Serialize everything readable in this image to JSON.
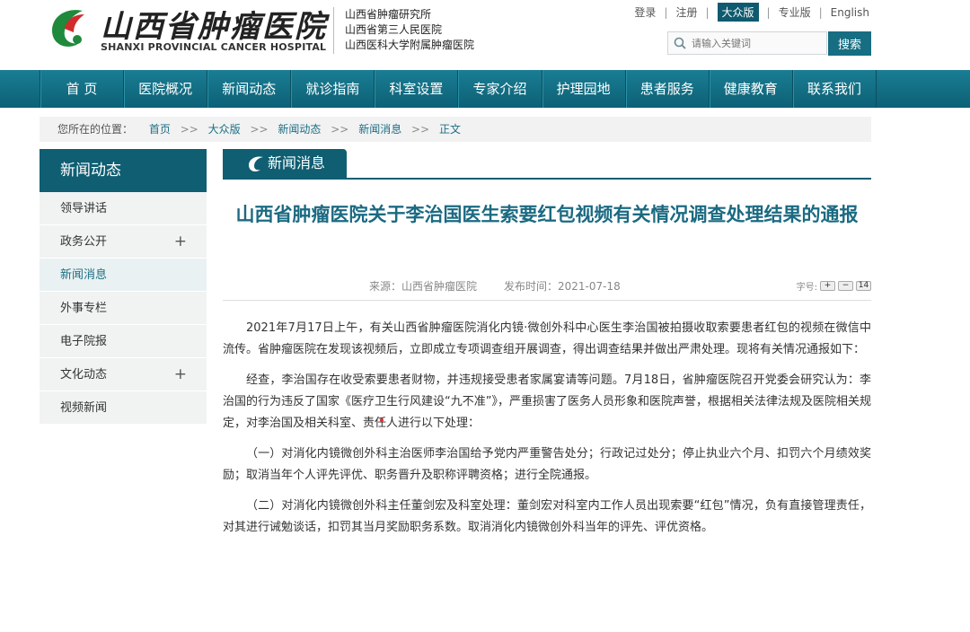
{
  "header": {
    "logo_cn": "山西省肿瘤医院",
    "logo_en": "SHANXI PROVINCIAL CANCER HOSPITAL",
    "affiliations": [
      "山西省肿瘤研究所",
      "山西省第三人民医院",
      "山西医科大学附属肿瘤医院"
    ],
    "topnav": {
      "login": "登录",
      "register": "注册",
      "public_version": "大众版",
      "pro_version": "专业版",
      "english": "English"
    },
    "search": {
      "placeholder": "请输入关键词",
      "button": "搜索"
    }
  },
  "mainnav": [
    "首 页",
    "医院概况",
    "新闻动态",
    "就诊指南",
    "科室设置",
    "专家介绍",
    "护理园地",
    "患者服务",
    "健康教育",
    "联系我们"
  ],
  "breadcrumb": {
    "prefix": "您所在的位置：",
    "items": [
      "首页",
      "大众版",
      "新闻动态",
      "新闻消息",
      "正文"
    ]
  },
  "sidebar": {
    "title": "新闻动态",
    "items": [
      {
        "label": "领导讲话",
        "expandable": false
      },
      {
        "label": "政务公开",
        "expandable": true
      },
      {
        "label": "新闻消息",
        "expandable": false,
        "current": true
      },
      {
        "label": "外事专栏",
        "expandable": false
      },
      {
        "label": "电子院报",
        "expandable": false
      },
      {
        "label": "文化动态",
        "expandable": true
      },
      {
        "label": "视频新闻",
        "expandable": false
      }
    ]
  },
  "section_tab": "新闻消息",
  "article": {
    "title": "山西省肿瘤医院关于李治国医生索要红包视频有关情况调查处理结果的通报",
    "source": "来源：山西省肿瘤医院",
    "date": "发布时间：2021-07-18",
    "font_size_label": "字号:",
    "font_buttons": [
      "+",
      "−",
      "14"
    ],
    "paragraphs": [
      "2021年7月17日上午，有关山西省肿瘤医院消化内镜·微创外科中心医生李治国被拍摄收取索要患者红包的视频在微信中流传。省肿瘤医院在发现该视频后，立即成立专项调查组开展调查，得出调查结果并做出严肃处理。现将有关情况通报如下：",
      "经查，李治国存在收受索要患者财物，并违规接受患者家属宴请等问题。7月18日，省肿瘤医院召开党委会研究认为：李治国的行为违反了国家《医疗卫生行风建设“九不准”》，严重损害了医务人员形象和医院声誉，根据相关法律法规及医院相关规定，对李治国及相关科室、责任人进行以下处理：",
      "（一）对消化内镜微创外科主治医师李治国给予党内严重警告处分；行政记过处分；停止执业六个月、扣罚六个月绩效奖励；取消当年个人评先评优、职务晋升及职称评聘资格；进行全院通报。",
      "（二）对消化内镜微创外科主任董剑宏及科室处理：董剑宏对科室内工作人员出现索要“红包”情况，负有直接管理责任，对其进行诫勉谈话，扣罚其当月奖励职务系数。取消消化内镜微创外科当年的评先、评优资格。"
    ]
  },
  "colors": {
    "brand": "#0f5e72",
    "title": "#1b6a82",
    "nav": "#176e83"
  }
}
